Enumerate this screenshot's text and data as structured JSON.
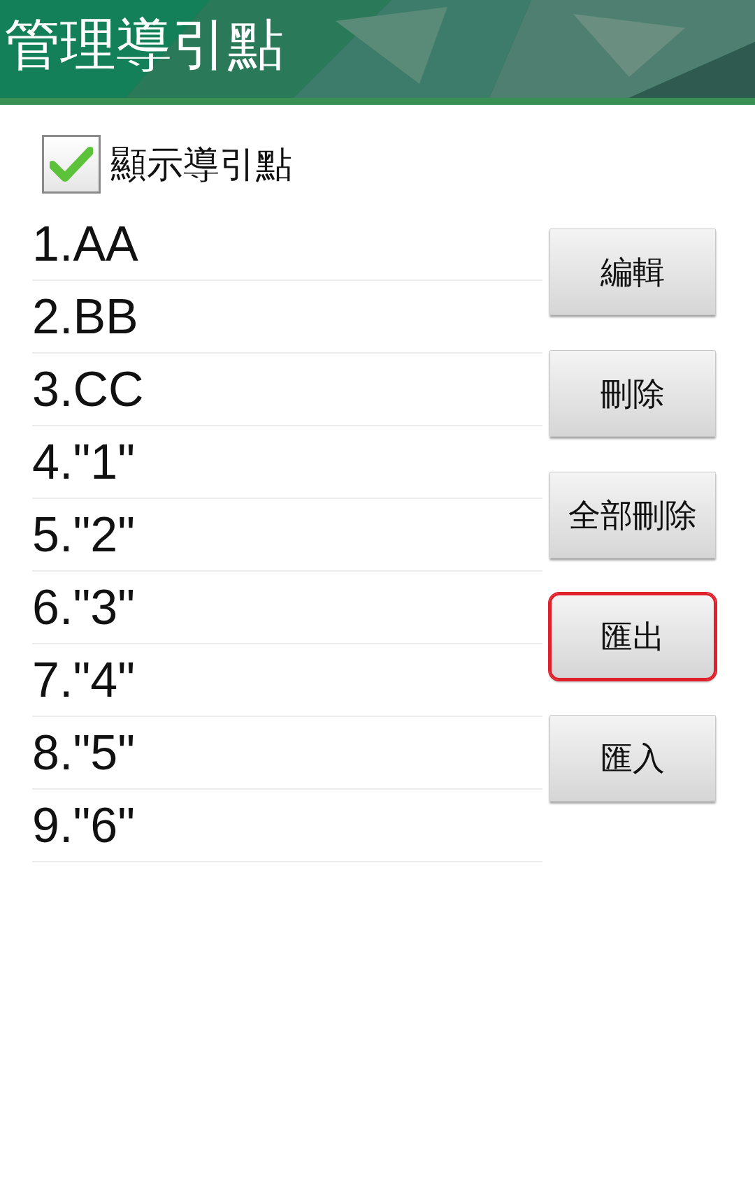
{
  "header": {
    "title": "管理導引點"
  },
  "show_checkbox": {
    "label": "顯示導引點",
    "checked": true
  },
  "items": [
    "1.AA",
    "2.BB",
    "3.CC",
    "4.\"1\"",
    "5.\"2\"",
    "6.\"3\"",
    "7.\"4\"",
    "8.\"5\"",
    "9.\"6\""
  ],
  "buttons": [
    {
      "label": "編輯",
      "highlighted": false
    },
    {
      "label": "刪除",
      "highlighted": false
    },
    {
      "label": "全部刪除",
      "highlighted": false
    },
    {
      "label": "匯出",
      "highlighted": true
    },
    {
      "label": "匯入",
      "highlighted": false
    }
  ]
}
